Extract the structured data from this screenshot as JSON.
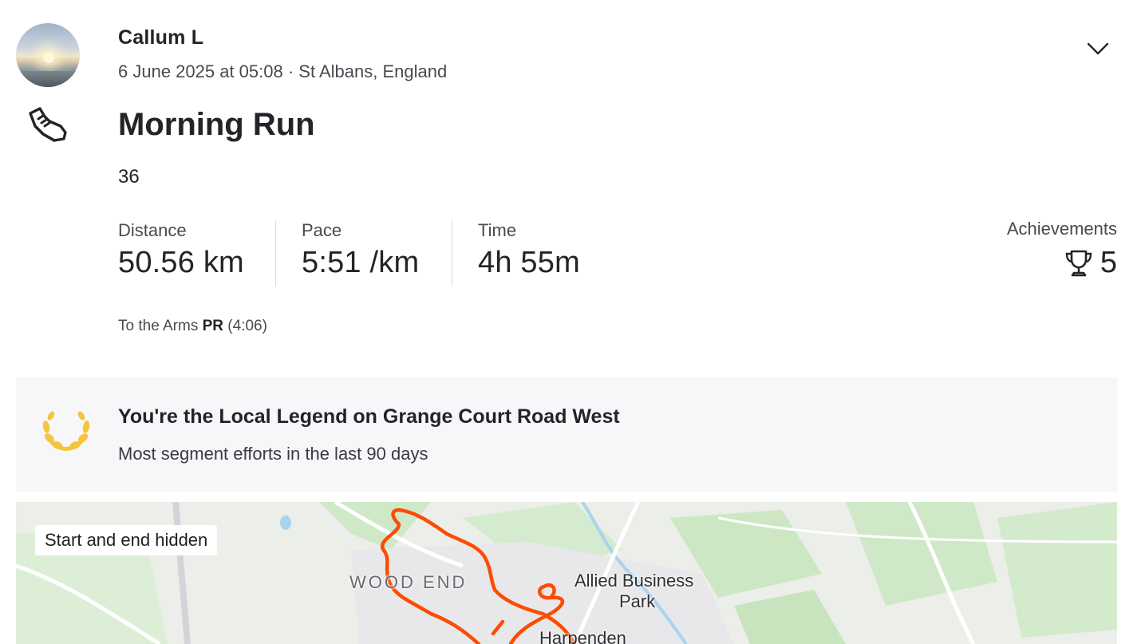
{
  "athlete": {
    "name": "Callum L",
    "avatar_icon": "avatar-photo"
  },
  "activity": {
    "datetime_location": "6 June 2025 at 05:08 · St Albans, England",
    "sport_icon": "running-shoe-icon",
    "title": "Morning Run",
    "description": "36"
  },
  "stats": [
    {
      "label": "Distance",
      "value": "50.56 km"
    },
    {
      "label": "Pace",
      "value": "5:51 /km"
    },
    {
      "label": "Time",
      "value": "4h 55m"
    }
  ],
  "achievements": {
    "label": "Achievements",
    "count": "5",
    "icon": "trophy-icon"
  },
  "pr": {
    "segment": "To the Arms",
    "badge": "PR",
    "time": "(4:06)"
  },
  "local_legend": {
    "title": "You're the Local Legend on Grange Court Road West",
    "subtitle": "Most segment efforts in the last 90 days",
    "icon": "laurel-icon",
    "accent": "#f5c53d"
  },
  "map": {
    "badge": "Start and end hidden",
    "labels": [
      "WOOD END",
      "Allied Business",
      "Park",
      "Harpenden"
    ],
    "route_color": "#fc4c02"
  },
  "menu": {
    "icon": "chevron-down-icon"
  }
}
